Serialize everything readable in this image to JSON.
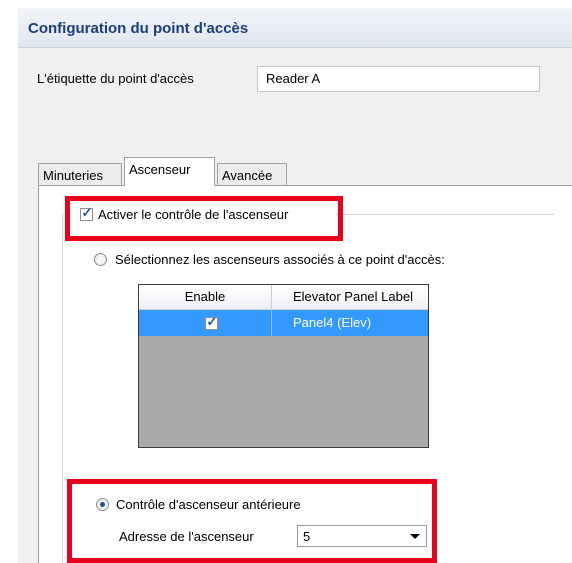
{
  "header": {
    "title": "Configuration du point d'accès"
  },
  "form": {
    "label_caption": "L'étiquette du point d'accès",
    "label_value": "Reader A"
  },
  "tabs": [
    {
      "label": "Minuteries"
    },
    {
      "label": "Ascenseur"
    },
    {
      "label": "Avancée"
    }
  ],
  "elevator": {
    "enable_control_label": "Activer le contrôle de l'ascenseur",
    "enable_control_checked": true,
    "select_elevators_label": "Sélectionnez les ascenseurs associés à ce point d'accès:",
    "table": {
      "columns": [
        "Enable",
        "Elevator Panel Label"
      ],
      "rows": [
        {
          "enable": true,
          "label": "Panel4 (Elev)"
        }
      ]
    },
    "legacy_label": "Contrôle d'ascenseur antérieure",
    "legacy_selected": true,
    "address_label": "Adresse de l'ascenseur",
    "address_value": "5"
  },
  "colors": {
    "highlight": "#e8001c",
    "selection": "#3399ff",
    "title": "#1b3f7a"
  }
}
